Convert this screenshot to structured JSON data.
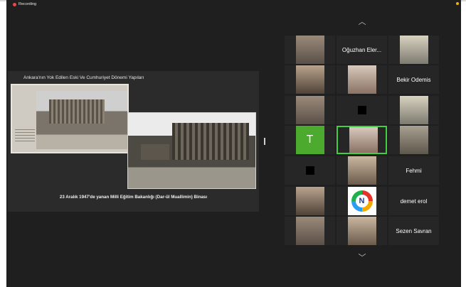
{
  "meeting": {
    "recording_label": "Recording"
  },
  "slide": {
    "title": "Ankara'nın Yok Edilen Eski Ve Cumhuriyet Dönemi Yapıları",
    "caption": "23 Aralık 1947'de yanan Milli Eğitim Bakanlığı (Dar-ül Muallimin) Binası"
  },
  "gallery": {
    "scroll_up_icon": "chevron-up-icon",
    "scroll_down_icon": "chevron-down-icon",
    "tiles": [
      {
        "type": "video",
        "label": ""
      },
      {
        "type": "name",
        "label": "Oğuzhan Eler..."
      },
      {
        "type": "video",
        "label": ""
      },
      {
        "type": "video",
        "label": ""
      },
      {
        "type": "video",
        "label": ""
      },
      {
        "type": "name",
        "label": "Bekir Odemis"
      },
      {
        "type": "video",
        "label": ""
      },
      {
        "type": "camoff",
        "label": ""
      },
      {
        "type": "video",
        "label": ""
      },
      {
        "type": "avatar",
        "label": "T"
      },
      {
        "type": "video-active",
        "label": ""
      },
      {
        "type": "video",
        "label": ""
      },
      {
        "type": "camoff",
        "label": ""
      },
      {
        "type": "video",
        "label": ""
      },
      {
        "type": "name",
        "label": "Fehmi"
      },
      {
        "type": "video",
        "label": ""
      },
      {
        "type": "logo",
        "label": "N"
      },
      {
        "type": "name",
        "label": "demet erol"
      },
      {
        "type": "video",
        "label": ""
      },
      {
        "type": "video",
        "label": ""
      },
      {
        "type": "name",
        "label": "Sezen Savran"
      }
    ]
  },
  "colors": {
    "background": "#1f1f1f",
    "tile": "#262626",
    "active_speaker": "#3fcf3f",
    "record": "#e5484d",
    "avatar": "#4caa2e"
  }
}
